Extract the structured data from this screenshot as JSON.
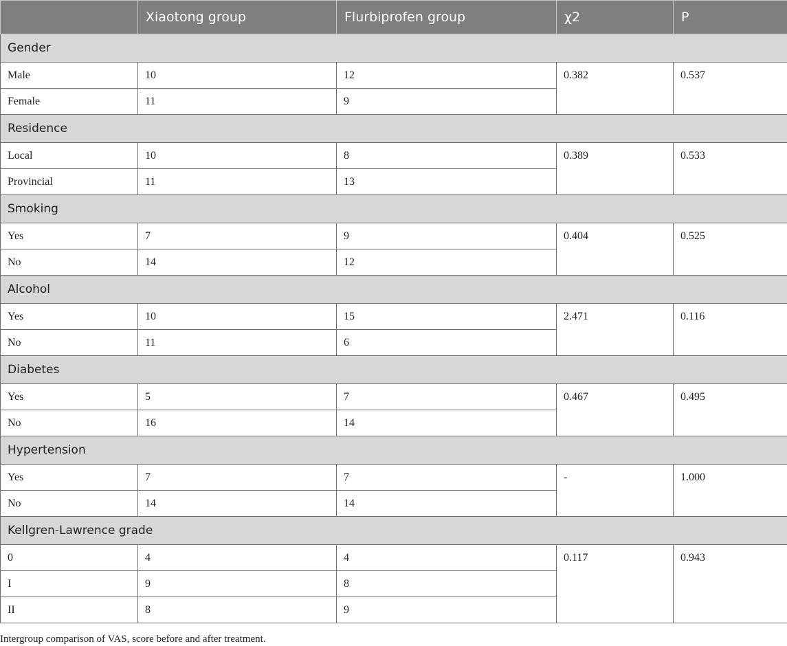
{
  "table": {
    "headers": [
      "",
      "Xiaotong group",
      "Flurbiprofen group",
      "χ2",
      "P"
    ],
    "sections": [
      {
        "title": "Gender",
        "chi2": "0.382",
        "p": "0.537",
        "rows": [
          {
            "label": "Male",
            "xiaotong": "10",
            "flurbiprofen": "12"
          },
          {
            "label": "Female",
            "xiaotong": "11",
            "flurbiprofen": "9"
          }
        ]
      },
      {
        "title": "Residence",
        "chi2": "0.389",
        "p": "0.533",
        "rows": [
          {
            "label": "Local",
            "xiaotong": "10",
            "flurbiprofen": "8"
          },
          {
            "label": "Provincial",
            "xiaotong": "11",
            "flurbiprofen": "13"
          }
        ]
      },
      {
        "title": "Smoking",
        "chi2": "0.404",
        "p": "0.525",
        "rows": [
          {
            "label": "Yes",
            "xiaotong": "7",
            "flurbiprofen": "9"
          },
          {
            "label": "No",
            "xiaotong": "14",
            "flurbiprofen": "12"
          }
        ]
      },
      {
        "title": "Alcohol",
        "chi2": "2.471",
        "p": "0.116",
        "rows": [
          {
            "label": "Yes",
            "xiaotong": "10",
            "flurbiprofen": "15"
          },
          {
            "label": "No",
            "xiaotong": "11",
            "flurbiprofen": "6"
          }
        ]
      },
      {
        "title": "Diabetes",
        "chi2": "0.467",
        "p": "0.495",
        "rows": [
          {
            "label": "Yes",
            "xiaotong": "5",
            "flurbiprofen": "7"
          },
          {
            "label": "No",
            "xiaotong": "16",
            "flurbiprofen": "14"
          }
        ]
      },
      {
        "title": "Hypertension",
        "chi2": "-",
        "p": "1.000",
        "rows": [
          {
            "label": "Yes",
            "xiaotong": "7",
            "flurbiprofen": "7"
          },
          {
            "label": "No",
            "xiaotong": "14",
            "flurbiprofen": "14"
          }
        ]
      },
      {
        "title": "Kellgren-Lawrence grade",
        "chi2": "0.117",
        "p": "0.943",
        "rows": [
          {
            "label": "0",
            "xiaotong": "4",
            "flurbiprofen": "4"
          },
          {
            "label": "I",
            "xiaotong": "9",
            "flurbiprofen": "8"
          },
          {
            "label": "II",
            "xiaotong": "8",
            "flurbiprofen": "9"
          }
        ]
      }
    ]
  },
  "caption": "Intergroup comparison of VAS, score before and after treatment."
}
